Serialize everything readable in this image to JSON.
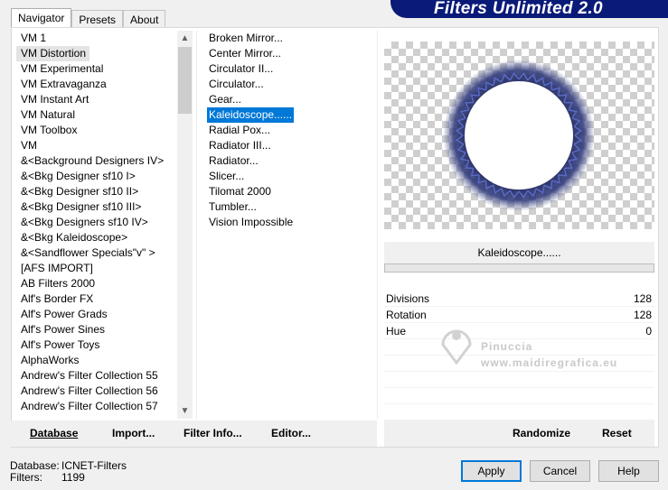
{
  "title": "Filters Unlimited 2.0",
  "tabs": [
    "Navigator",
    "Presets",
    "About"
  ],
  "categories": [
    "VM 1",
    "VM Distortion",
    "VM Experimental",
    "VM Extravaganza",
    "VM Instant Art",
    "VM Natural",
    "VM Toolbox",
    "VM",
    "&<Background Designers IV>",
    "&<Bkg Designer sf10 I>",
    "&<Bkg Designer sf10 II>",
    "&<Bkg Designer sf10 III>",
    "&<Bkg Designers sf10 IV>",
    "&<Bkg Kaleidoscope>",
    "&<Sandflower Specials\"v\" >",
    "[AFS IMPORT]",
    "AB Filters 2000",
    "Alf's Border FX",
    "Alf's Power Grads",
    "Alf's Power Sines",
    "Alf's Power Toys",
    "AlphaWorks",
    "Andrew's Filter Collection 55",
    "Andrew's Filter Collection 56",
    "Andrew's Filter Collection 57"
  ],
  "selected_category": "VM Distortion",
  "filters": [
    "Broken Mirror...",
    "Center Mirror...",
    "Circulator II...",
    "Circulator...",
    "Gear...",
    "Kaleidoscope......",
    "Radial Pox...",
    "Radiator III...",
    "Radiator...",
    "Slicer...",
    "Tilomat 2000",
    "Tumbler...",
    "Vision Impossible"
  ],
  "selected_filter": "Kaleidoscope......",
  "current_filter_name": "Kaleidoscope......",
  "params": [
    {
      "label": "Divisions",
      "value": "128"
    },
    {
      "label": "Rotation",
      "value": "128"
    },
    {
      "label": "Hue",
      "value": "0"
    }
  ],
  "watermark": {
    "line1": "Pinuccia",
    "line2": "www.maidiregrafica.eu"
  },
  "toolbar": {
    "database": "Database",
    "import": "Import...",
    "filter_info": "Filter Info...",
    "editor": "Editor...",
    "randomize": "Randomize",
    "reset": "Reset"
  },
  "status": {
    "database_label": "Database:",
    "database_value": "ICNET-Filters",
    "filters_label": "Filters:",
    "filters_value": "1199"
  },
  "buttons": {
    "apply": "Apply",
    "cancel": "Cancel",
    "help": "Help"
  },
  "colors": {
    "banner": "#0a1a78",
    "selection": "#0078d7",
    "ring": "#1c2560"
  }
}
